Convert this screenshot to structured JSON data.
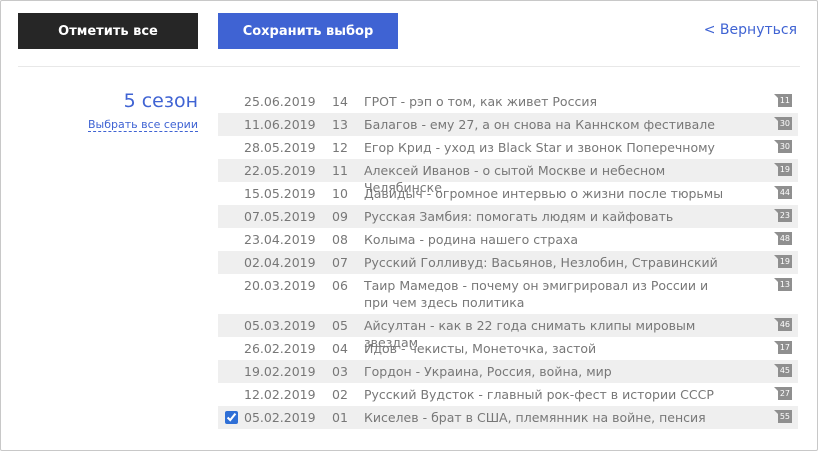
{
  "header": {
    "mark_all_label": "Отметить все",
    "save_label": "Сохранить выбор",
    "back_label": "< Вернуться"
  },
  "season": {
    "title": "5 сезон",
    "select_all_label": "Выбрать все серии"
  },
  "episodes": [
    {
      "date": "25.06.2019",
      "number": "14",
      "title": "ГРОТ - рэп о том, как живет Россия",
      "comments": "11",
      "checked": false
    },
    {
      "date": "11.06.2019",
      "number": "13",
      "title": "Балагов - ему 27, а он снова на Каннском фестивале",
      "comments": "30",
      "checked": false
    },
    {
      "date": "28.05.2019",
      "number": "12",
      "title": "Егор Крид - уход из Black Star и звонок Поперечному",
      "comments": "30",
      "checked": false
    },
    {
      "date": "22.05.2019",
      "number": "11",
      "title": "Алексей Иванов - о сытой Москве и небесном Челябинске",
      "comments": "19",
      "checked": false
    },
    {
      "date": "15.05.2019",
      "number": "10",
      "title": "Давидыч - огромное интервью о жизни после тюрьмы",
      "comments": "44",
      "checked": false
    },
    {
      "date": "07.05.2019",
      "number": "09",
      "title": "Русская Замбия: помогать людям и кайфовать",
      "comments": "23",
      "checked": false
    },
    {
      "date": "23.04.2019",
      "number": "08",
      "title": "Колыма - родина нашего страха",
      "comments": "48",
      "checked": false
    },
    {
      "date": "02.04.2019",
      "number": "07",
      "title": "Русский Голливуд: Васьянов, Незлобин, Стравинский",
      "comments": "19",
      "checked": false
    },
    {
      "date": "20.03.2019",
      "number": "06",
      "title": "Таир Мамедов - почему он эмигрировал из России и при чем здесь политика",
      "comments": "13",
      "checked": false
    },
    {
      "date": "05.03.2019",
      "number": "05",
      "title": "Айсултан - как в 22 года снимать клипы мировым звездам",
      "comments": "46",
      "checked": false
    },
    {
      "date": "26.02.2019",
      "number": "04",
      "title": "Идов - чекисты, Монеточка, застой",
      "comments": "17",
      "checked": false
    },
    {
      "date": "19.02.2019",
      "number": "03",
      "title": "Гордон - Украина, Россия, война, мир",
      "comments": "45",
      "checked": false
    },
    {
      "date": "12.02.2019",
      "number": "02",
      "title": "Русский Вудсток - главный рок-фест в истории СССР",
      "comments": "27",
      "checked": false
    },
    {
      "date": "05.02.2019",
      "number": "01",
      "title": "Киселев - брат в США, племянник на войне, пенсия",
      "comments": "55",
      "checked": true
    }
  ],
  "colors": {
    "accent": "#3f63d3",
    "dark_button": "#262626",
    "row_stripe": "#efefef",
    "badge": "#8f8f8f"
  }
}
